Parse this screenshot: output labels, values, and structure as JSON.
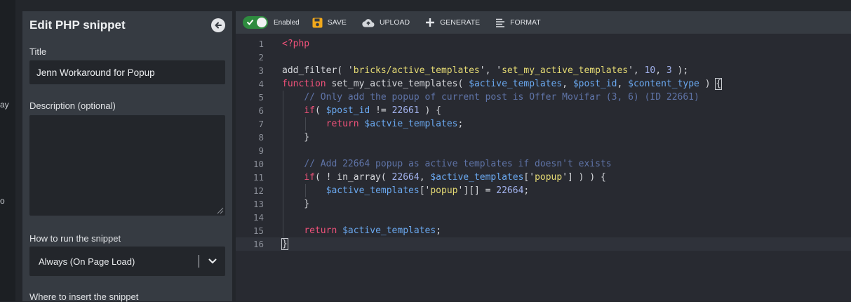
{
  "left_strip": {
    "fragment_1": "ay",
    "fragment_2": "o"
  },
  "panel": {
    "title": "Edit PHP snippet",
    "title_label": "Title",
    "title_value": "Jenn Workaround for Popup",
    "description_label": "Description (optional)",
    "description_value": "",
    "run_label": "How to run the snippet",
    "run_value": "Always (On Page Load)",
    "insert_label": "Where to insert the snippet"
  },
  "toolbar": {
    "enabled_label": "Enabled",
    "enabled_state": true,
    "save_label": "SAVE",
    "upload_label": "UPLOAD",
    "generate_label": "GENERATE",
    "format_label": "FORMAT"
  },
  "colors": {
    "toggle_on": "#2e8b3f",
    "save_icon": "#f1a81b",
    "keyword": "#f0527a",
    "string": "#e6db74",
    "variable": "#6aa8ef",
    "comment": "#5f74a8"
  },
  "icons": [
    "check-icon",
    "save-icon",
    "cloud-upload-icon",
    "plus-icon",
    "format-lines-icon",
    "back-arrow-icon",
    "chevron-down-icon"
  ],
  "editor": {
    "active_line": 16,
    "lines": [
      {
        "n": "1",
        "code": "<?php"
      },
      {
        "n": "2",
        "code": ""
      },
      {
        "n": "3",
        "code": "add_filter( 'bricks/active_templates', 'set_my_active_templates', 10, 3 );"
      },
      {
        "n": "4",
        "code": "function set_my_active_templates( $active_templates, $post_id, $content_type ) {"
      },
      {
        "n": "5",
        "code": "    // Only add the popup of current post is Offer Movifar (3, 6) (ID 22661)"
      },
      {
        "n": "6",
        "code": "    if( $post_id != 22661 ) {"
      },
      {
        "n": "7",
        "code": "        return $actvie_templates;"
      },
      {
        "n": "8",
        "code": "    }"
      },
      {
        "n": "9",
        "code": ""
      },
      {
        "n": "10",
        "code": "    // Add 22664 popup as active templates if doesn't exists"
      },
      {
        "n": "11",
        "code": "    if( ! in_array( 22664, $active_templates['popup'] ) ) {"
      },
      {
        "n": "12",
        "code": "        $active_templates['popup'][] = 22664;"
      },
      {
        "n": "13",
        "code": "    }"
      },
      {
        "n": "14",
        "code": ""
      },
      {
        "n": "15",
        "code": "    return $active_templates;"
      },
      {
        "n": "16",
        "code": "}"
      }
    ]
  }
}
